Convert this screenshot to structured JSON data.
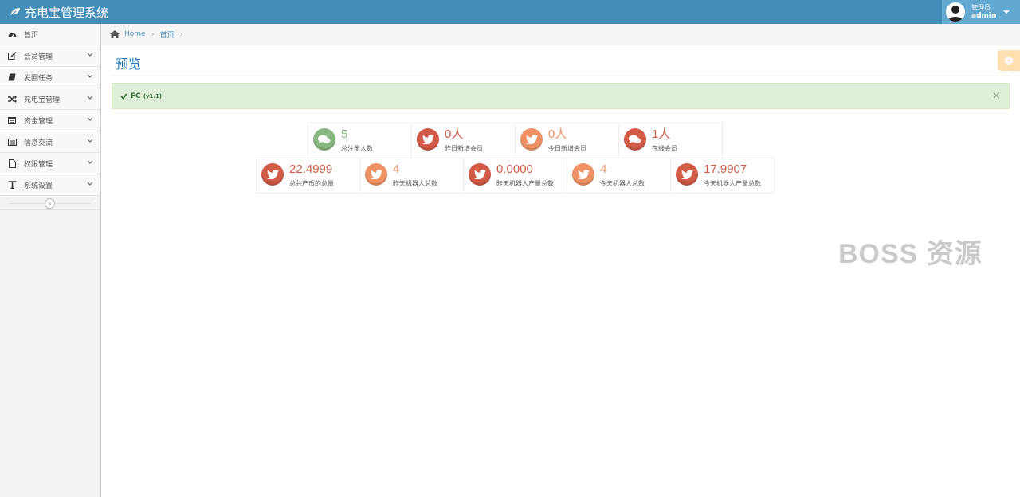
{
  "app": {
    "title": "充电宝管理系统",
    "brand_color": "#438eb9"
  },
  "user": {
    "role": "管理员",
    "name": "admin"
  },
  "sidebar": {
    "items": [
      {
        "label": "首页",
        "icon": "dashboard-icon",
        "has_submenu": false
      },
      {
        "label": "会员管理",
        "icon": "edit-icon",
        "has_submenu": true
      },
      {
        "label": "发圈任务",
        "icon": "book-icon",
        "has_submenu": true
      },
      {
        "label": "充电宝管理",
        "icon": "random-icon",
        "has_submenu": true
      },
      {
        "label": "资金管理",
        "icon": "calendar-icon",
        "has_submenu": true
      },
      {
        "label": "信息交流",
        "icon": "list-alt-icon",
        "has_submenu": true
      },
      {
        "label": "权限管理",
        "icon": "file-icon",
        "has_submenu": true
      },
      {
        "label": "系统设置",
        "icon": "text-icon",
        "has_submenu": true
      }
    ],
    "collapse_symbol": "«"
  },
  "breadcrumbs": {
    "home": "Home",
    "current": "首页"
  },
  "page": {
    "title": "预览"
  },
  "alert": {
    "text": "FC",
    "version": "(v1.1)",
    "close": "×"
  },
  "stats": {
    "row1": [
      {
        "value": "5",
        "label": "总注册人数",
        "icon": "comments-icon",
        "color": "#87b87f"
      },
      {
        "value": "0人",
        "label": "昨日新增会员",
        "icon": "twitter-icon",
        "color": "#d15b47"
      },
      {
        "value": "0人",
        "label": "今日新增会员",
        "icon": "twitter-icon",
        "color": "#ee9266"
      },
      {
        "value": "1人",
        "label": "在线会员",
        "icon": "comments-icon",
        "color": "#d15b47"
      }
    ],
    "row2": [
      {
        "value": "22.4999",
        "label": "总共产币的总量",
        "icon": "twitter-icon",
        "color": "#d15b47"
      },
      {
        "value": "4",
        "label": "昨天机器人总数",
        "icon": "twitter-icon",
        "color": "#ee9266"
      },
      {
        "value": "0.0000",
        "label": "昨天机器人产量总数",
        "icon": "twitter-icon",
        "color": "#d15b47"
      },
      {
        "value": "4",
        "label": "今天机器人总数",
        "icon": "twitter-icon",
        "color": "#ee9266"
      },
      {
        "value": "17.9907",
        "label": "今天机器人产量总数",
        "icon": "twitter-icon",
        "color": "#d15b47"
      }
    ]
  },
  "watermark": "BOSS 资源"
}
